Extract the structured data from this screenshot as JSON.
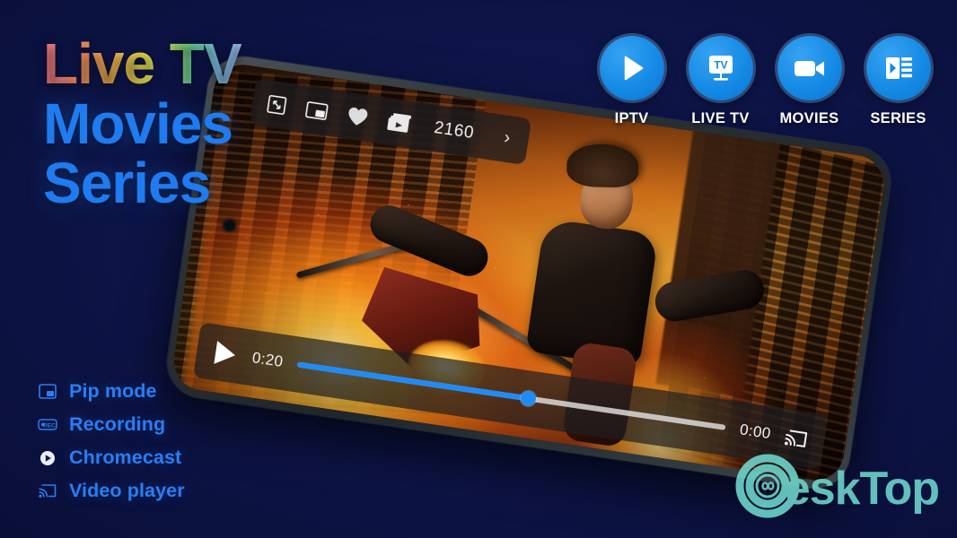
{
  "background_color": "#0d1446",
  "headline": {
    "line1": "Live TV",
    "line2": "Movies",
    "line3": "Series",
    "gradient_colors": [
      "#f77b8e",
      "#f4b14f",
      "#f2e34f",
      "#6fd89a",
      "#9fb4f2"
    ],
    "blue_color": "#1f7bf0"
  },
  "nav": {
    "accent_color": "#1489e4",
    "items": [
      {
        "label": "IPTV",
        "icon": "play-icon"
      },
      {
        "label": "LIVE TV",
        "icon": "tv-icon"
      },
      {
        "label": "MOVIES",
        "icon": "video-camera-icon"
      },
      {
        "label": "SERIES",
        "icon": "playlist-icon"
      }
    ]
  },
  "features": {
    "color": "#2a7ef2",
    "items": [
      {
        "label": "Pip mode",
        "icon": "pip-icon"
      },
      {
        "label": "Recording",
        "icon": "rec-icon"
      },
      {
        "label": "Chromecast",
        "icon": "play-circle-icon"
      },
      {
        "label": "Video player",
        "icon": "cast-icon"
      }
    ]
  },
  "player": {
    "top_controls": [
      {
        "name": "fullscreen-icon"
      },
      {
        "name": "pip-icon"
      },
      {
        "name": "heart-icon"
      },
      {
        "name": "video-library-icon"
      }
    ],
    "quality_label": "2160",
    "quality_chevron": "›",
    "play_state": "paused",
    "current_time": "0:20",
    "duration": "0:00",
    "progress_percent": 54,
    "progress_color": "#1f8cf5",
    "cast_icon": "cast-icon"
  },
  "watermark": {
    "text": "eskTop",
    "color": "#6fd8cf",
    "logo": "desktop-d-infinity-logo"
  }
}
